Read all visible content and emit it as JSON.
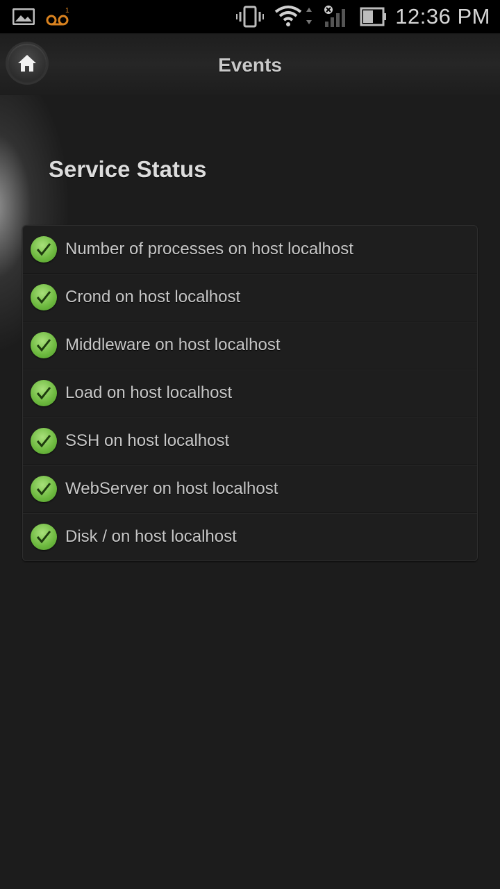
{
  "status_bar": {
    "time": "12:36 PM",
    "icons": [
      "gallery-icon",
      "voicemail-icon",
      "vibrate-icon",
      "wifi-icon",
      "signal-icon",
      "battery-icon"
    ],
    "voicemail_color": "#d9821f"
  },
  "header": {
    "title": "Events",
    "home_icon": "home-icon"
  },
  "main": {
    "section_title": "Service Status",
    "status_color": "#6cb83e",
    "items": [
      {
        "label": "Number of processes on host localhost",
        "status": "ok"
      },
      {
        "label": "Crond on host localhost",
        "status": "ok"
      },
      {
        "label": "Middleware on host localhost",
        "status": "ok"
      },
      {
        "label": "Load on host localhost",
        "status": "ok"
      },
      {
        "label": "SSH on host localhost",
        "status": "ok"
      },
      {
        "label": "WebServer on host localhost",
        "status": "ok"
      },
      {
        "label": "Disk / on host localhost",
        "status": "ok"
      }
    ]
  }
}
